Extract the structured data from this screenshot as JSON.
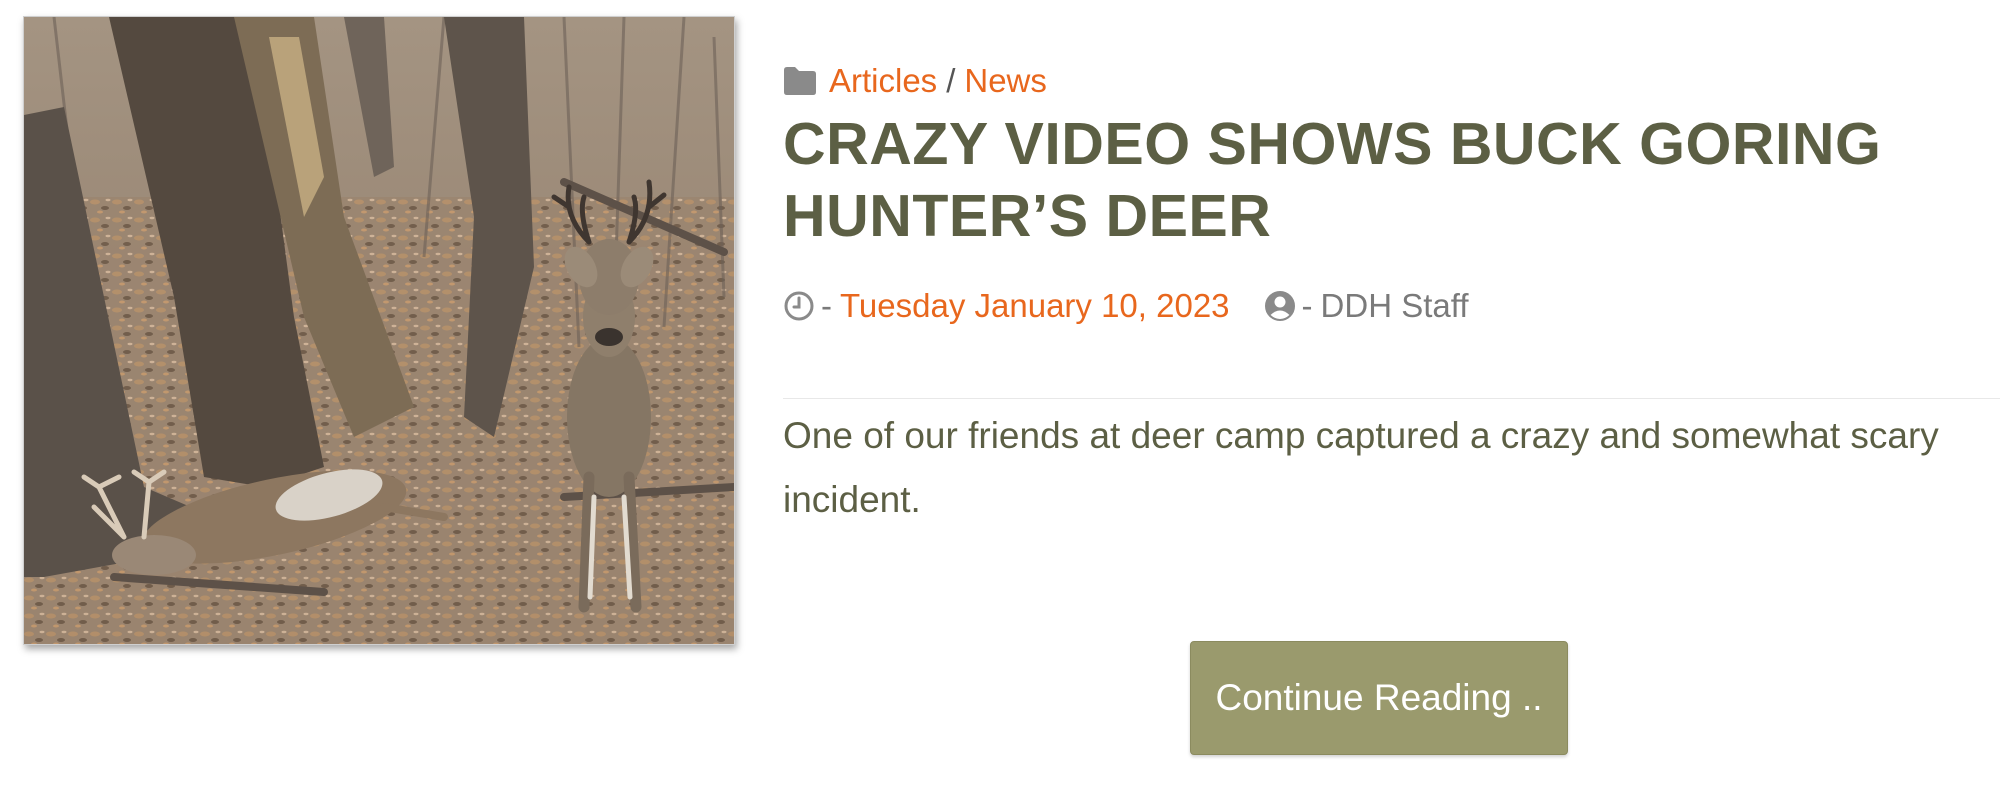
{
  "article": {
    "thumbnail": {
      "alt": "Buck standing over a downed deer in the woods"
    },
    "categories": {
      "icon": "folder-icon",
      "items": [
        "Articles",
        "News"
      ],
      "separator": "/"
    },
    "title": "CRAZY VIDEO SHOWS BUCK GORING HUNTER’S DEER",
    "meta": {
      "date_icon": "clock-icon",
      "date_prefix": "-",
      "date": "Tuesday January 10, 2023",
      "author_icon": "user-circle-icon",
      "author_prefix": "-",
      "author": "DDH Staff"
    },
    "excerpt": "One of our friends at deer camp captured a crazy and somewhat scary incident.",
    "continue_label": "Continue Reading .."
  },
  "colors": {
    "accent": "#e8671d",
    "title": "#5c5f44",
    "button_bg": "#9a9a6d",
    "meta_gray": "#7a7a7a"
  }
}
